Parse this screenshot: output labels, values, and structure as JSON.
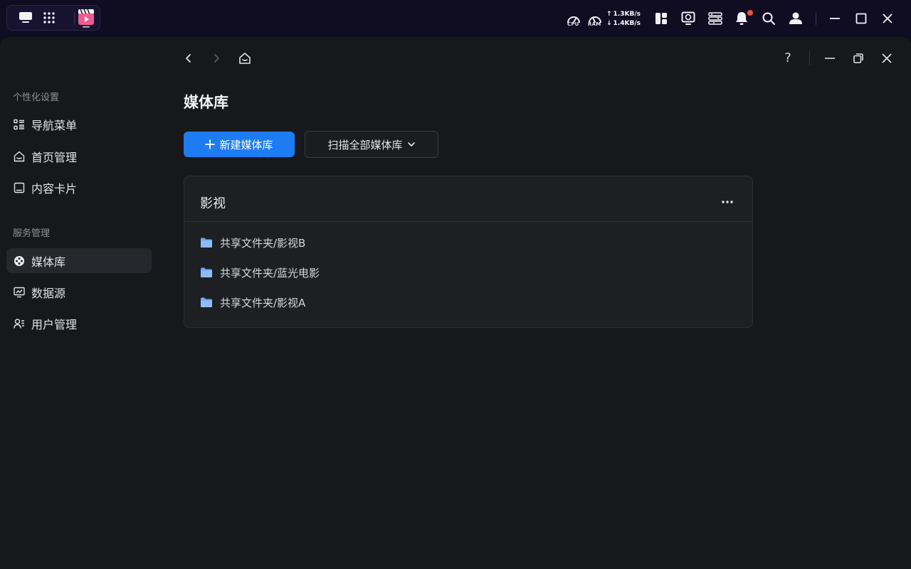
{
  "os_bar": {
    "cpu_label": "CPU",
    "ram_label": "RAM",
    "upload_speed": "1.3KB/s",
    "download_speed": "1.4KB/s",
    "notification_dot_color": "#f0503d"
  },
  "window": {
    "page_title": "媒体库",
    "help_label": "?"
  },
  "sidebar": {
    "groups": [
      {
        "title": "个性化设置"
      },
      {
        "title": "服务管理"
      }
    ],
    "items": [
      {
        "label": "导航菜单",
        "icon": "list-icon"
      },
      {
        "label": "首页管理",
        "icon": "home-icon"
      },
      {
        "label": "内容卡片",
        "icon": "card-icon"
      },
      {
        "label": "媒体库",
        "icon": "film-reel-icon",
        "active": true
      },
      {
        "label": "数据源",
        "icon": "monitor-chart-icon"
      },
      {
        "label": "用户管理",
        "icon": "users-icon"
      }
    ]
  },
  "toolbar": {
    "new_library_label": "新建媒体库",
    "scan_all_label": "扫描全部媒体库"
  },
  "library_card": {
    "title": "影视",
    "folders": [
      "共享文件夹/影视B",
      "共享文件夹/蓝光电影",
      "共享文件夹/影视A"
    ]
  },
  "colors": {
    "accent": "#1e7cf2",
    "folder": "#6fa8f5"
  }
}
